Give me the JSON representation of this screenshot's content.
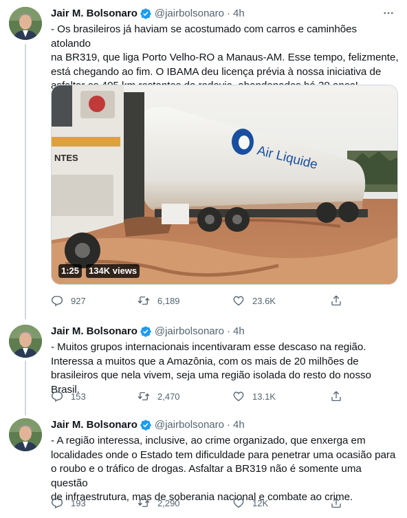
{
  "tweets": [
    {
      "name": "Jair M. Bolsonaro",
      "handle": "@jairbolsonaro",
      "time": "4h",
      "text_lines": [
        "- Os brasileiros já haviam se acostumado com carros e caminhões atolando",
        "na BR319, que liga Porto Velho-RO a Manaus-AM. Esse tempo, felizmente,",
        "está chegando ao fim. O IBAMA deu licença prévia à nossa iniciativa de",
        "asfaltar os 405 km restantes da rodovia, abandonados há 30 anos!"
      ],
      "video": {
        "duration": "1:25",
        "views": "134K views",
        "truck_logo": "Air Liquide",
        "cab_text": "NTES"
      },
      "replies": "927",
      "retweets": "6,189",
      "likes": "23.6K"
    },
    {
      "name": "Jair M. Bolsonaro",
      "handle": "@jairbolsonaro",
      "time": "4h",
      "text_lines": [
        "- Muitos grupos internacionais incentivaram esse descaso na região.",
        "Interessa a muitos que a Amazônia, com os mais de 20 milhões de",
        "brasileiros que nela vivem, seja uma região isolada do resto do nosso Brasil."
      ],
      "replies": "153",
      "retweets": "2,470",
      "likes": "13.1K"
    },
    {
      "name": "Jair M. Bolsonaro",
      "handle": "@jairbolsonaro",
      "time": "4h",
      "text_lines": [
        "- A região interessa, inclusive, ao crime organizado, que enxerga em",
        "localidades onde o Estado tem dificuldade para penetrar uma ocasião para",
        "o roubo e o tráfico de drogas. Asfaltar a BR319 não é somente uma questão",
        "de infraestrutura, mas de soberania nacional e combate ao crime."
      ],
      "replies": "193",
      "retweets": "2,290",
      "likes": "12K"
    }
  ],
  "colors": {
    "accent": "#1d9bf0",
    "muted": "#536471",
    "text": "#0f1419",
    "thread_line": "#cfd9de"
  },
  "icons": [
    "verified-badge-icon",
    "more-icon",
    "reply-icon",
    "retweet-icon",
    "like-icon",
    "share-icon"
  ]
}
